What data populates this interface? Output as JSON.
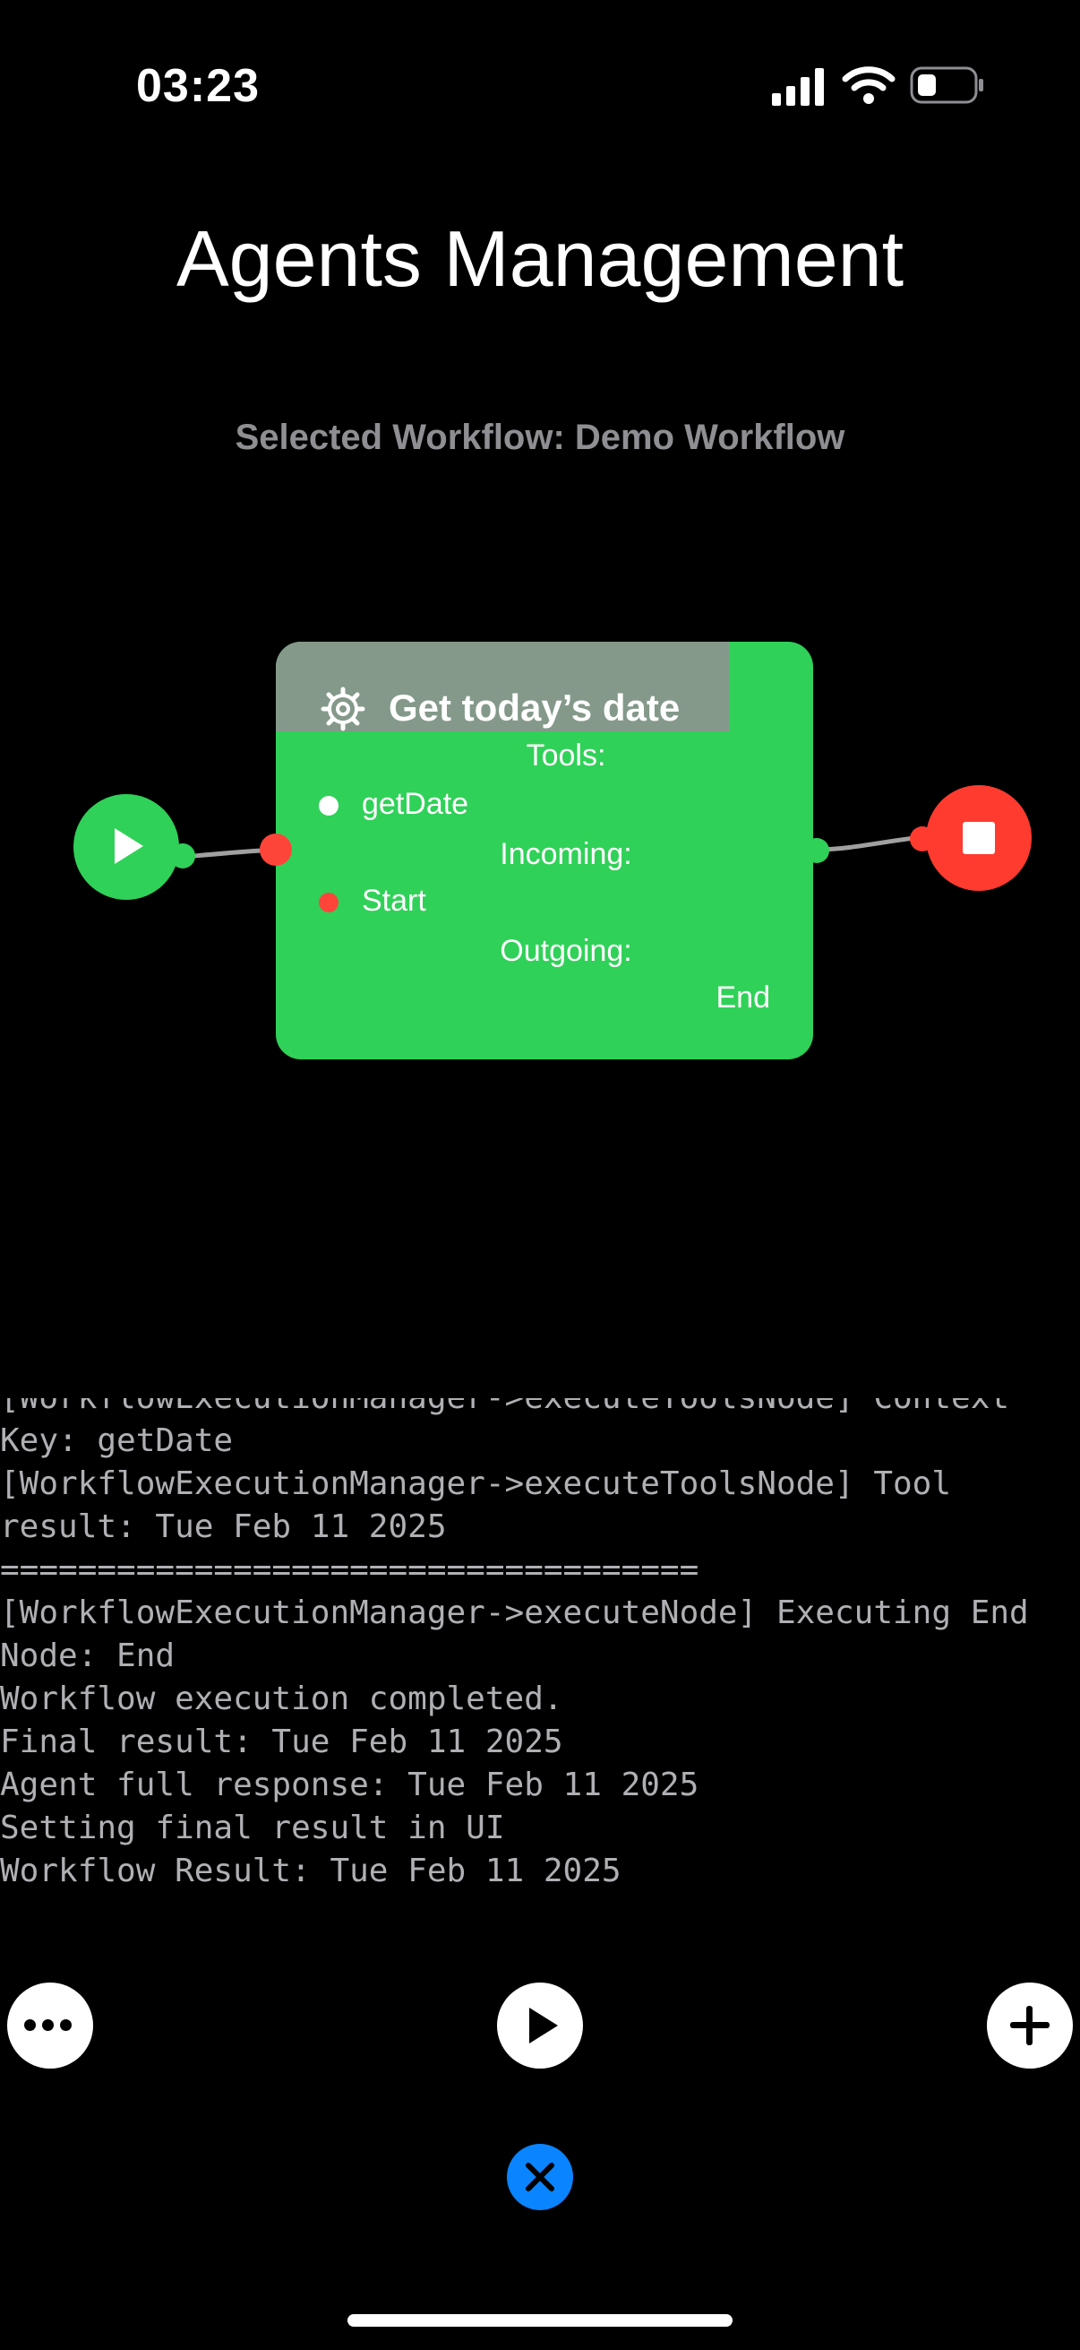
{
  "status_bar": {
    "time": "03:23"
  },
  "header": {
    "title": "Agents Management",
    "subtitle": "Selected Workflow: Demo Workflow"
  },
  "workflow": {
    "start_node_icon": "play-icon",
    "end_node_icon": "stop-icon",
    "card": {
      "icon": "gear-icon",
      "title": "Get today’s date",
      "tools_label": "Tools:",
      "tools": [
        "getDate"
      ],
      "incoming_label": "Incoming:",
      "incoming": [
        "Start"
      ],
      "outgoing_label": "Outgoing:",
      "outgoing": [
        "End"
      ],
      "colors": {
        "card": "#30d158",
        "header": "#84998a",
        "port_in": "#ff453a",
        "tool_dot": "#ffffff"
      }
    }
  },
  "console": {
    "lines": [
      "[WorkflowExecutionManager->executeToolsNode] Context",
      "Key: getDate",
      "[WorkflowExecutionManager->executeToolsNode] Tool",
      "result: Tue Feb 11 2025",
      "====================================",
      "[WorkflowExecutionManager->executeNode] Executing End",
      "Node: End",
      "Workflow execution completed.",
      "Final result: Tue Feb 11 2025",
      "Agent full response: Tue Feb 11 2025",
      "Setting final result in UI",
      "Workflow Result: Tue Feb 11 2025"
    ]
  },
  "toolbar": {
    "more_icon": "more-icon",
    "play_icon": "play-icon",
    "add_icon": "plus-icon",
    "close_icon": "close-icon",
    "close_color": "#0a84ff"
  }
}
